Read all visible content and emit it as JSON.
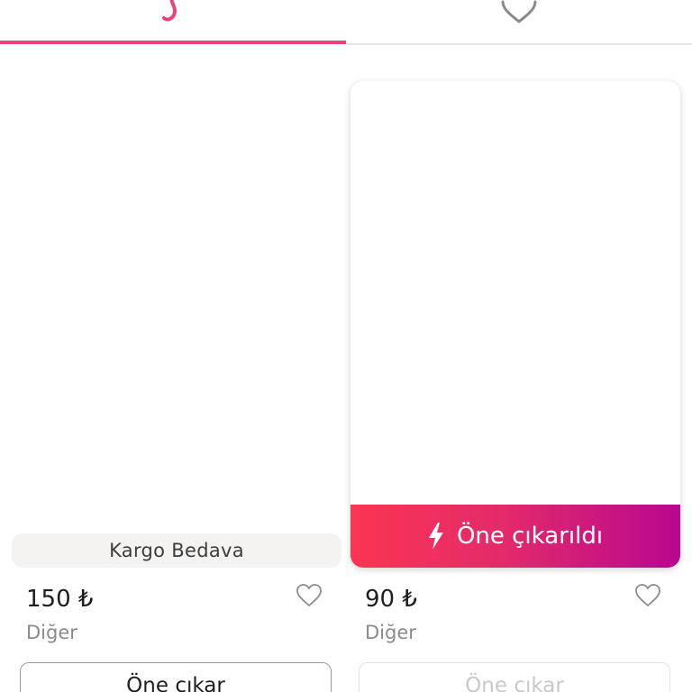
{
  "tabs": [
    {
      "name": "listings",
      "icon": "hanger-icon",
      "active": true
    },
    {
      "name": "favorites",
      "icon": "heart-icon",
      "active": false
    }
  ],
  "colors": {
    "accent": "#e8437d",
    "banner_start": "#fb3451",
    "banner_end": "#b8078f"
  },
  "products": [
    {
      "badge": "Kargo Bedava",
      "price": "150 ₺",
      "category": "Diğer",
      "promote_label": "Öne çıkar"
    },
    {
      "featured_label": "Öne çıkarıldı",
      "price": "90 ₺",
      "category": "Diğer",
      "promote_label": "Öne çıkar"
    }
  ]
}
